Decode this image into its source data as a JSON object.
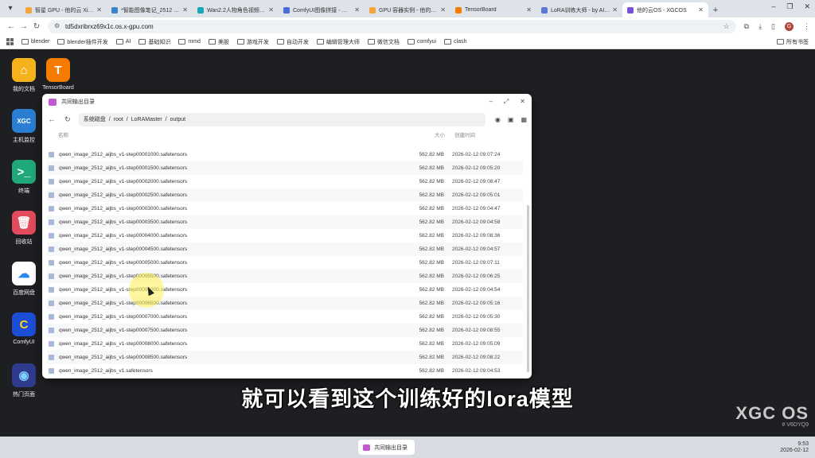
{
  "browser": {
    "tabs": [
      {
        "title": "智星 GPU - 他的云 Xiang...",
        "color": "#f4a43a",
        "active": false
      },
      {
        "title": "*智能图像笔记_2512 - C...",
        "color": "#3b82c4",
        "active": false
      },
      {
        "title": "Wan2.2人物角色视频生成...",
        "color": "#1aa6b7",
        "active": false
      },
      {
        "title": "ComfyUI图像拼接 - 一键式...",
        "color": "#4a6cd4",
        "active": false
      },
      {
        "title": "GPU 容器实例 - 他的云 X...",
        "color": "#f4a43a",
        "active": false
      },
      {
        "title": "TensorBoard",
        "color": "#f57c00",
        "active": false
      },
      {
        "title": "LoRA训练大师 - by AI的...",
        "color": "#5a7ad6",
        "active": false
      },
      {
        "title": "他的云OS - XGCOS",
        "color": "#7b4fd6",
        "active": true
      }
    ],
    "new_tab": "+",
    "window_controls": [
      "–",
      "❐",
      "✕"
    ],
    "url": "td5dxribrxz69x1c.os.x-gpu.com",
    "profile_initial": "G",
    "bookmarks": [
      "blender",
      "blender插件开发",
      "AI",
      "基础知识",
      "mmd",
      "美股",
      "游戏开发",
      "自动开发",
      "编辑管理大师",
      "微信文档",
      "comfyui",
      "clash"
    ],
    "bookmarks_all": "所有书签"
  },
  "desktop": {
    "icons": [
      {
        "label": "我的文档",
        "bg": "#f6b21a",
        "glyph": "⌂",
        "glyph_color": "#fff"
      },
      {
        "label": "TensorBoard",
        "bg": "#f57c00",
        "glyph": "T",
        "glyph_color": "#fff"
      },
      {
        "label": "主机监控",
        "bg": "#2a7fd4",
        "glyph": "XGC",
        "glyph_color": "#fff"
      },
      {
        "label": "终端",
        "bg": "#1fa97a",
        "glyph": ">_",
        "glyph_color": "#fff"
      },
      {
        "label": "回收站",
        "bg": "#e24b5b",
        "glyph": "🗑",
        "glyph_color": "#fff"
      },
      {
        "label": "百度网盘",
        "bg": "#ffffff",
        "glyph": "☁",
        "glyph_color": "#2a86f0"
      },
      {
        "label": "ComfyUI",
        "bg": "#1c4ed8",
        "glyph": "C",
        "glyph_color": "#ffd21f"
      },
      {
        "label": "热门页面",
        "bg": "#2f3b8f",
        "glyph": "◉",
        "glyph_color": "#7fd0ff"
      }
    ]
  },
  "file_window": {
    "title": "共同输出目录",
    "path": [
      "系统磁盘",
      "/",
      "root",
      "/",
      "LoRAMaster",
      "/",
      "output"
    ],
    "columns": {
      "name": "名称",
      "size": "大小",
      "time": "创建时间"
    },
    "files": [
      {
        "name": "qwen_image_2512_aijbs_v1-step00001000.safetensors",
        "size": "562.82 MB",
        "time": "2026-02-12 09:07:24"
      },
      {
        "name": "qwen_image_2512_aijbs_v1-step00001500.safetensors",
        "size": "562.82 MB",
        "time": "2026-02-12 09:05:20"
      },
      {
        "name": "qwen_image_2512_aijbs_v1-step00002000.safetensors",
        "size": "562.82 MB",
        "time": "2026-02-12 09:08:47"
      },
      {
        "name": "qwen_image_2512_aijbs_v1-step00002500.safetensors",
        "size": "562.82 MB",
        "time": "2026-02-12 09:05:01"
      },
      {
        "name": "qwen_image_2512_aijbs_v1-step00003000.safetensors",
        "size": "562.82 MB",
        "time": "2026-02-12 09:04:47"
      },
      {
        "name": "qwen_image_2512_aijbs_v1-step00003500.safetensors",
        "size": "562.82 MB",
        "time": "2026-02-12 09:04:58"
      },
      {
        "name": "qwen_image_2512_aijbs_v1-step00004000.safetensors",
        "size": "562.82 MB",
        "time": "2026-02-12 09:08:36"
      },
      {
        "name": "qwen_image_2512_aijbs_v1-step00004500.safetensors",
        "size": "562.82 MB",
        "time": "2026-02-12 09:04:57"
      },
      {
        "name": "qwen_image_2512_aijbs_v1-step00005000.safetensors",
        "size": "562.82 MB",
        "time": "2026-02-12 09:07:11"
      },
      {
        "name": "qwen_image_2512_aijbs_v1-step00005500.safetensors",
        "size": "562.82 MB",
        "time": "2026-02-12 09:06:25"
      },
      {
        "name": "qwen_image_2512_aijbs_v1-step00006000.safetensors",
        "size": "562.82 MB",
        "time": "2026-02-12 09:04:54"
      },
      {
        "name": "qwen_image_2512_aijbs_v1-step00006500.safetensors",
        "size": "562.82 MB",
        "time": "2026-02-12 09:05:16"
      },
      {
        "name": "qwen_image_2512_aijbs_v1-step00007000.safetensors",
        "size": "562.82 MB",
        "time": "2026-02-12 09:05:30"
      },
      {
        "name": "qwen_image_2512_aijbs_v1-step00007500.safetensors",
        "size": "562.82 MB",
        "time": "2026-02-12 09:08:55"
      },
      {
        "name": "qwen_image_2512_aijbs_v1-step00008000.safetensors",
        "size": "562.82 MB",
        "time": "2026-02-12 09:05:09"
      },
      {
        "name": "qwen_image_2512_aijbs_v1-step00008500.safetensors",
        "size": "562.82 MB",
        "time": "2026-02-12 09:08:22"
      },
      {
        "name": "qwen_image_2512_aijbs_v1.safetensors",
        "size": "562.82 MB",
        "time": "2026-02-12 09:04:53"
      }
    ]
  },
  "subtitle": "就可以看到这个训练好的lora模型",
  "watermark": {
    "brand": "XGC OS",
    "code": "# V6DYQ9"
  },
  "taskbar": {
    "item_label": "共同输出目录",
    "time": "9:53",
    "date": "2026-02-12"
  }
}
